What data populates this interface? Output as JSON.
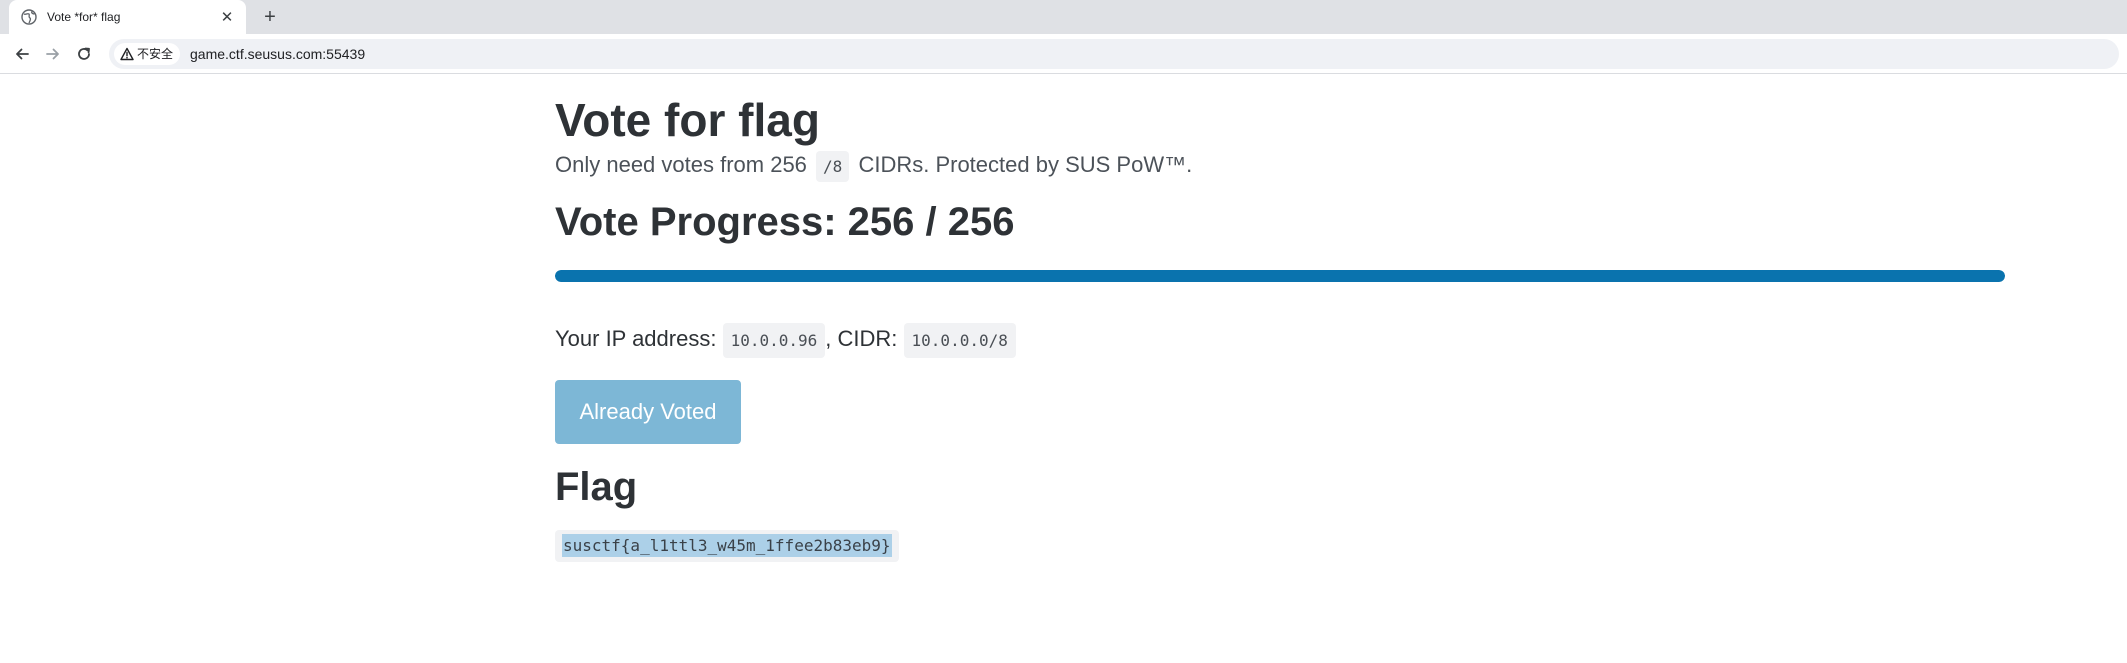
{
  "browser": {
    "tab_title": "Vote *for* flag",
    "tab_close": "✕",
    "new_tab": "+",
    "security_label": "不安全",
    "url": "game.ctf.seusus.com:55439"
  },
  "page": {
    "title": "Vote for flag",
    "subtitle_prefix": "Only need votes from 256",
    "subtitle_code": "/8",
    "subtitle_suffix": "CIDRs. Protected by SUS PoW™.",
    "progress_heading": "Vote Progress: 256 / 256",
    "progress": {
      "current": 256,
      "total": 256
    },
    "ip_label": "Your IP address:",
    "ip_value": "10.0.0.96",
    "cidr_label": ", CIDR:",
    "cidr_value": "10.0.0.0/8",
    "vote_button_label": "Already Voted",
    "flag_heading": "Flag",
    "flag_value": "susctf{a_l1ttl3_w45m_1ffee2b83eb9}"
  },
  "colors": {
    "progress_fill": "#0a73ae",
    "button_disabled": "#7db7d6",
    "flag_selection": "#acd0e8"
  },
  "icons": {
    "tab_favicon": "globe-icon",
    "back": "arrow-left-icon",
    "forward": "arrow-right-icon",
    "reload": "reload-icon",
    "security": "warning-triangle-icon"
  }
}
